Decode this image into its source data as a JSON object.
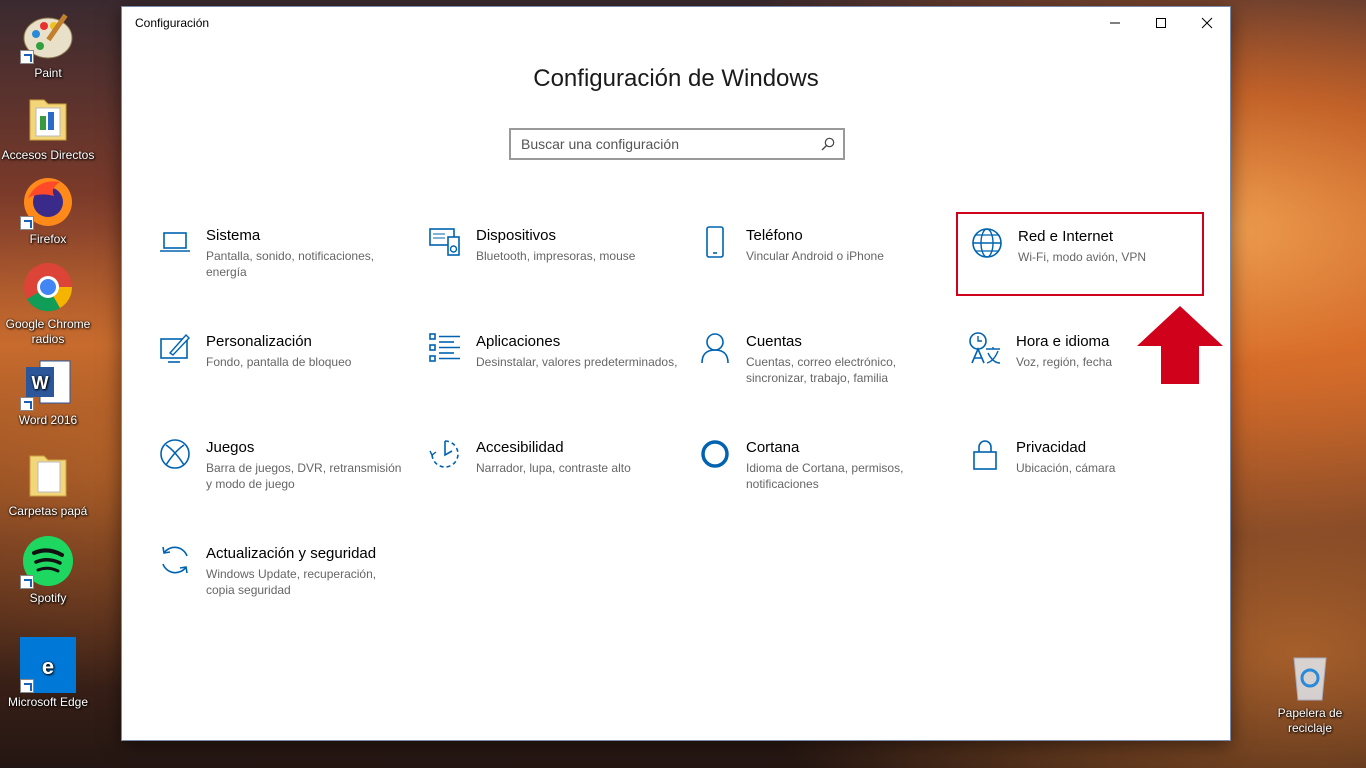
{
  "desktop": {
    "icons": [
      {
        "label": "Paint"
      },
      {
        "label": "Accesos Directos"
      },
      {
        "label": "Firefox"
      },
      {
        "label": "Google Chrome radios"
      },
      {
        "label": "Word 2016"
      },
      {
        "label": "Carpetas papá"
      },
      {
        "label": "Spotify"
      },
      {
        "label": "Microsoft Edge"
      },
      {
        "label": "Papelera de reciclaje"
      }
    ]
  },
  "window": {
    "title": "Configuración",
    "heading": "Configuración de Windows",
    "search_placeholder": "Buscar una configuración",
    "accent_color": "#0063b1",
    "highlight_color": "#d0021b",
    "tiles": [
      {
        "title": "Sistema",
        "desc": "Pantalla, sonido, notificaciones, energía",
        "icon": "laptop-icon"
      },
      {
        "title": "Dispositivos",
        "desc": "Bluetooth, impresoras, mouse",
        "icon": "devices-icon"
      },
      {
        "title": "Teléfono",
        "desc": "Vincular Android o iPhone",
        "icon": "phone-icon"
      },
      {
        "title": "Red e Internet",
        "desc": "Wi-Fi, modo avión, VPN",
        "icon": "globe-icon"
      },
      {
        "title": "Personalización",
        "desc": "Fondo, pantalla de bloqueo",
        "icon": "personalization-icon"
      },
      {
        "title": "Aplicaciones",
        "desc": "Desinstalar, valores predeterminados,",
        "icon": "apps-list-icon"
      },
      {
        "title": "Cuentas",
        "desc": "Cuentas, correo electrónico, sincronizar, trabajo, familia",
        "icon": "person-icon"
      },
      {
        "title": "Hora e idioma",
        "desc": "Voz, región, fecha",
        "icon": "time-language-icon"
      },
      {
        "title": "Juegos",
        "desc": "Barra de juegos, DVR, retransmisión y modo de juego",
        "icon": "xbox-icon"
      },
      {
        "title": "Accesibilidad",
        "desc": "Narrador, lupa, contraste alto",
        "icon": "accessibility-icon"
      },
      {
        "title": "Cortana",
        "desc": "Idioma de Cortana, permisos, notificaciones",
        "icon": "cortana-icon"
      },
      {
        "title": "Privacidad",
        "desc": "Ubicación, cámara",
        "icon": "lock-icon"
      },
      {
        "title": "Actualización y seguridad",
        "desc": "Windows Update, recuperación, copia seguridad",
        "icon": "update-icon"
      }
    ]
  }
}
